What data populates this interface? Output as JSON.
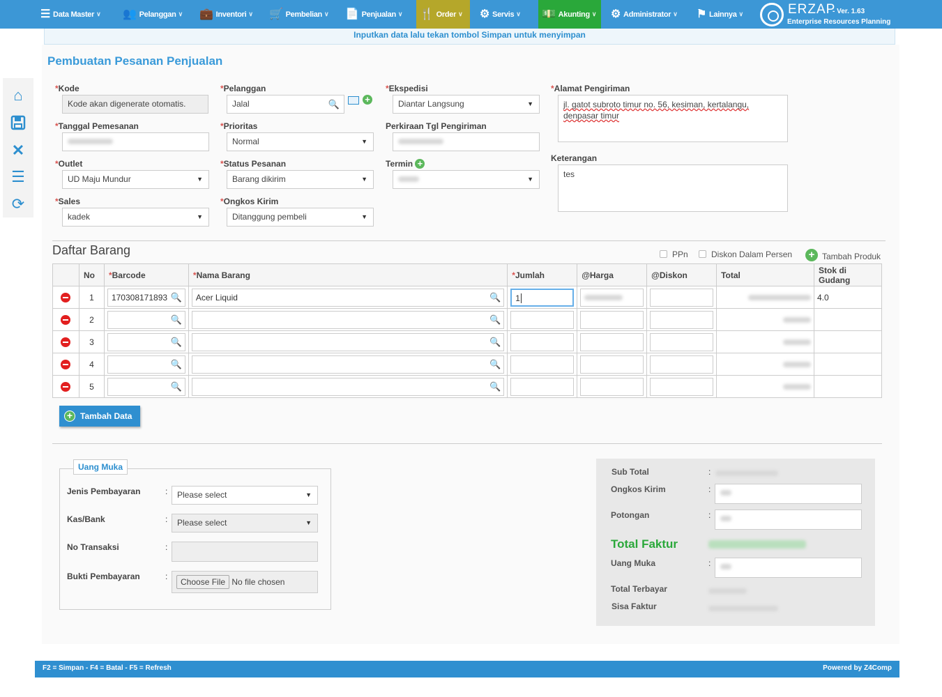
{
  "nav": {
    "items": [
      {
        "label": "Data Master",
        "icon": "list-icon"
      },
      {
        "label": "Pelanggan",
        "icon": "users-icon"
      },
      {
        "label": "Inventori",
        "icon": "briefcase-icon"
      },
      {
        "label": "Pembelian",
        "icon": "cart-icon"
      },
      {
        "label": "Penjualan",
        "icon": "document-icon"
      },
      {
        "label": "Order",
        "icon": "cutlery-icon"
      },
      {
        "label": "Servis",
        "icon": "gears-icon"
      },
      {
        "label": "Akunting",
        "icon": "money-icon"
      },
      {
        "label": "Administrator",
        "icon": "gear-icon"
      },
      {
        "label": "Lainnya",
        "icon": "flag-icon"
      }
    ],
    "colors": {
      "bar": "#3c97d6",
      "order": "#b5a72a",
      "akunting": "#2aa83a"
    }
  },
  "logo": {
    "name": "ERZAP",
    "version": "- Ver. 1.63",
    "subtitle": "Enterprise Resources Planning"
  },
  "message": "Inputkan data lalu tekan tombol Simpan untuk menyimpan",
  "page_title": "Pembuatan Pesanan Penjualan",
  "form": {
    "kode": {
      "label": "Kode",
      "value": "Kode akan digenerate otomatis."
    },
    "tanggal": {
      "label": "Tanggal Pemesanan",
      "value": ""
    },
    "outlet": {
      "label": "Outlet",
      "value": "UD Maju Mundur"
    },
    "sales": {
      "label": "Sales",
      "value": "kadek"
    },
    "pelanggan": {
      "label": "Pelanggan",
      "value": "Jalal"
    },
    "prioritas": {
      "label": "Prioritas",
      "value": "Normal"
    },
    "status": {
      "label": "Status Pesanan",
      "value": "Barang dikirim"
    },
    "ongkos": {
      "label": "Ongkos Kirim",
      "value": "Ditanggung pembeli"
    },
    "ekspedisi": {
      "label": "Ekspedisi",
      "value": "Diantar Langsung"
    },
    "perkiraan": {
      "label": "Perkiraan Tgl Pengiriman",
      "value": ""
    },
    "termin": {
      "label": "Termin",
      "value": ""
    },
    "alamat": {
      "label": "Alamat Pengiriman",
      "line1": "jl. gatot subroto timur no. 56, kesiman, kertalangu,",
      "line2": "denpasar timur"
    },
    "keterangan": {
      "label": "Keterangan",
      "value": "tes"
    }
  },
  "items": {
    "title": "Daftar Barang",
    "ppn_label": "PPn",
    "diskon_persen_label": "Diskon Dalam Persen",
    "tambah_produk_label": "Tambah Produk",
    "headers": {
      "no": "No",
      "barcode": "Barcode",
      "nama": "Nama Barang",
      "jumlah": "Jumlah",
      "harga": "@Harga",
      "diskon": "@Diskon",
      "total": "Total",
      "stok": "Stok di Gudang"
    },
    "rows": [
      {
        "no": "1",
        "barcode": "170308171893",
        "nama": "Acer Liquid",
        "jumlah": "1",
        "stok": "4.0"
      },
      {
        "no": "2",
        "barcode": "",
        "nama": "",
        "jumlah": "",
        "stok": ""
      },
      {
        "no": "3",
        "barcode": "",
        "nama": "",
        "jumlah": "",
        "stok": ""
      },
      {
        "no": "4",
        "barcode": "",
        "nama": "",
        "jumlah": "",
        "stok": ""
      },
      {
        "no": "5",
        "barcode": "",
        "nama": "",
        "jumlah": "",
        "stok": ""
      }
    ],
    "tambah_data_label": "Tambah Data"
  },
  "uang_muka": {
    "legend": "Uang Muka",
    "jenis_label": "Jenis Pembayaran",
    "jenis_value": "Please select",
    "kas_label": "Kas/Bank",
    "kas_value": "Please select",
    "no_label": "No Transaksi",
    "bukti_label": "Bukti Pembayaran",
    "file_button": "Choose File",
    "file_text": "No file chosen"
  },
  "summary": {
    "sub_total": "Sub Total",
    "ongkos_kirim": "Ongkos Kirim",
    "potongan": "Potongan",
    "total_faktur": "Total Faktur",
    "uang_muka": "Uang Muka",
    "total_terbayar": "Total Terbayar",
    "sisa_faktur": "Sisa Faktur",
    "total_color": "#2aa83a"
  },
  "footer": {
    "shortcuts": "F2 = Simpan - F4 = Batal - F5 = Refresh",
    "powered": "Powered by Z4Comp"
  }
}
